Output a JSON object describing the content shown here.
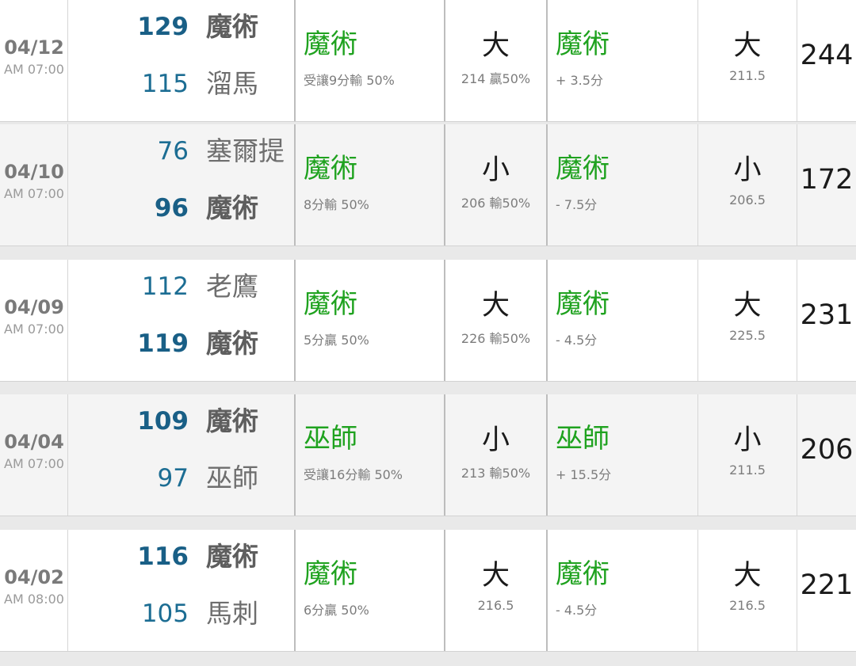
{
  "rows": [
    {
      "date": "04/12",
      "time": "AM 07:00",
      "team1": {
        "score": "129",
        "name": "魔術",
        "win": true
      },
      "team2": {
        "score": "115",
        "name": "溜馬",
        "win": false
      },
      "spread": {
        "pick": "魔術",
        "detail": "受讓9分輸 50%"
      },
      "ou": {
        "pick": "大",
        "detail": "214  贏50%"
      },
      "line": {
        "pick": "魔術",
        "detail": "+ 3.5分"
      },
      "total_pick": {
        "pick": "大",
        "detail": "211.5"
      },
      "total": "244"
    },
    {
      "date": "04/10",
      "time": "AM 07:00",
      "team1": {
        "score": "76",
        "name": "塞爾提",
        "win": false
      },
      "team2": {
        "score": "96",
        "name": "魔術",
        "win": true
      },
      "spread": {
        "pick": "魔術",
        "detail": "8分輸 50%"
      },
      "ou": {
        "pick": "小",
        "detail": "206  輸50%"
      },
      "line": {
        "pick": "魔術",
        "detail": "- 7.5分"
      },
      "total_pick": {
        "pick": "小",
        "detail": "206.5"
      },
      "total": "172"
    },
    {
      "date": "04/09",
      "time": "AM 07:00",
      "team1": {
        "score": "112",
        "name": "老鷹",
        "win": false
      },
      "team2": {
        "score": "119",
        "name": "魔術",
        "win": true
      },
      "spread": {
        "pick": "魔術",
        "detail": "5分贏 50%"
      },
      "ou": {
        "pick": "大",
        "detail": "226  輸50%"
      },
      "line": {
        "pick": "魔術",
        "detail": "- 4.5分"
      },
      "total_pick": {
        "pick": "大",
        "detail": "225.5"
      },
      "total": "231"
    },
    {
      "date": "04/04",
      "time": "AM 07:00",
      "team1": {
        "score": "109",
        "name": "魔術",
        "win": true
      },
      "team2": {
        "score": "97",
        "name": "巫師",
        "win": false
      },
      "spread": {
        "pick": "巫師",
        "detail": "受讓16分輸 50%"
      },
      "ou": {
        "pick": "小",
        "detail": "213  輸50%"
      },
      "line": {
        "pick": "巫師",
        "detail": "+ 15.5分"
      },
      "total_pick": {
        "pick": "小",
        "detail": "211.5"
      },
      "total": "206"
    },
    {
      "date": "04/02",
      "time": "AM 08:00",
      "team1": {
        "score": "116",
        "name": "魔術",
        "win": true
      },
      "team2": {
        "score": "105",
        "name": "馬刺",
        "win": false
      },
      "spread": {
        "pick": "魔術",
        "detail": "6分贏 50%"
      },
      "ou": {
        "pick": "大",
        "detail": "216.5"
      },
      "line": {
        "pick": "魔術",
        "detail": "- 4.5分"
      },
      "total_pick": {
        "pick": "大",
        "detail": "216.5"
      },
      "total": "221"
    }
  ]
}
